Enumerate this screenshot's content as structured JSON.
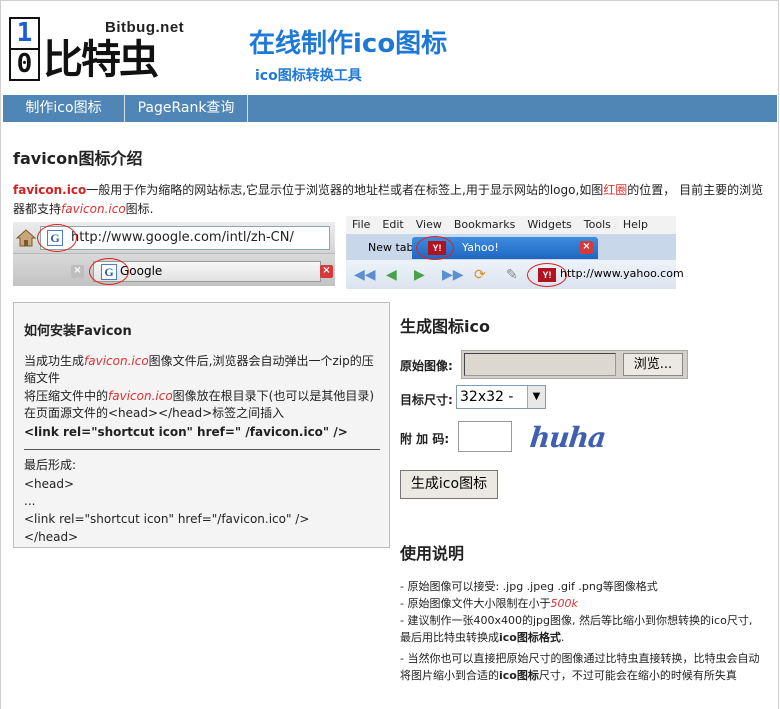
{
  "header": {
    "logo_digit_top": "1",
    "logo_digit_bottom": "0",
    "logo_domain": "Bitbug.net",
    "logo_brand": "比特虫",
    "title": "在线制作ico图标",
    "subtitle": "ico图标转换工具"
  },
  "nav": {
    "items": [
      {
        "label": "制作ico图标"
      },
      {
        "label": "PageRank查询"
      }
    ]
  },
  "intro": {
    "heading": "favicon图标介绍",
    "term": "favicon.ico",
    "text1": "一般用于作为缩略的网站标志,它显示位于浏览器的地址栏或者在标签上,用于显示网站的logo,如图",
    "red_circle": "红圈",
    "text2": "的位置， 目前主要的浏览器都支持",
    "term_italic": "favicon.ico",
    "text3": "图标."
  },
  "browser_demo_a": {
    "url": "http://www.google.com/intl/zh-CN/",
    "tab_title": "Google"
  },
  "browser_demo_b": {
    "menu": [
      "File",
      "Edit",
      "View",
      "Bookmarks",
      "Widgets",
      "Tools",
      "Help"
    ],
    "tab_new": "New tab",
    "tab_active": "Yahoo!",
    "yahoo_logo": "Y!",
    "url": "http://www.yahoo.com"
  },
  "install": {
    "heading": "如何安装Favicon",
    "line1_a": "当成功生成",
    "line1_term": "favicon.ico",
    "line1_b": "图像文件后,浏览器会自动弹出一个zip的压缩文件",
    "line2_a": "将压缩文件中的",
    "line2_term": "favicon.ico",
    "line2_b": "图像放在根目录下(也可以是其他目录)",
    "line3": "在页面源文件的<head></head>标签之间插入",
    "code_bold": "<link rel=\"shortcut icon\" href=\" /favicon.ico\" />",
    "final_label": "最后形成:",
    "final_1": "<head>",
    "final_2": "...",
    "final_3": "<link rel=\"shortcut icon\" href=\"/favicon.ico\" />",
    "final_4": "</head>"
  },
  "generator": {
    "heading": "生成图标ico",
    "source_label": "原始图像:",
    "browse_button": "浏览...",
    "size_label": "目标尺寸:",
    "size_value": "32x32 -",
    "code_label": "附 加 码:",
    "captcha_text": "huha",
    "generate_button": "生成ico图标"
  },
  "usage": {
    "heading": "使用说明",
    "items": [
      "- 原始图像可以接受: .jpg .jpeg .gif .png等图像格式",
      "- 原始图像文件大小限制在小于",
      "- 建议制作一张400x400的jpg图像, 然后等比缩小到你想转换的ico尺寸,最后用比特虫转换成",
      "- 当然你也可以直接把原始尺寸的图像通过比特虫直接转换，比特虫会自动将图片缩小到合适的"
    ],
    "size_limit": "500k",
    "item3_bold": "ico图标格式",
    "item3_end": ".",
    "item4_bold": "ico图标",
    "item4_end": "尺寸，不过可能会在缩小的时候有所失真"
  }
}
